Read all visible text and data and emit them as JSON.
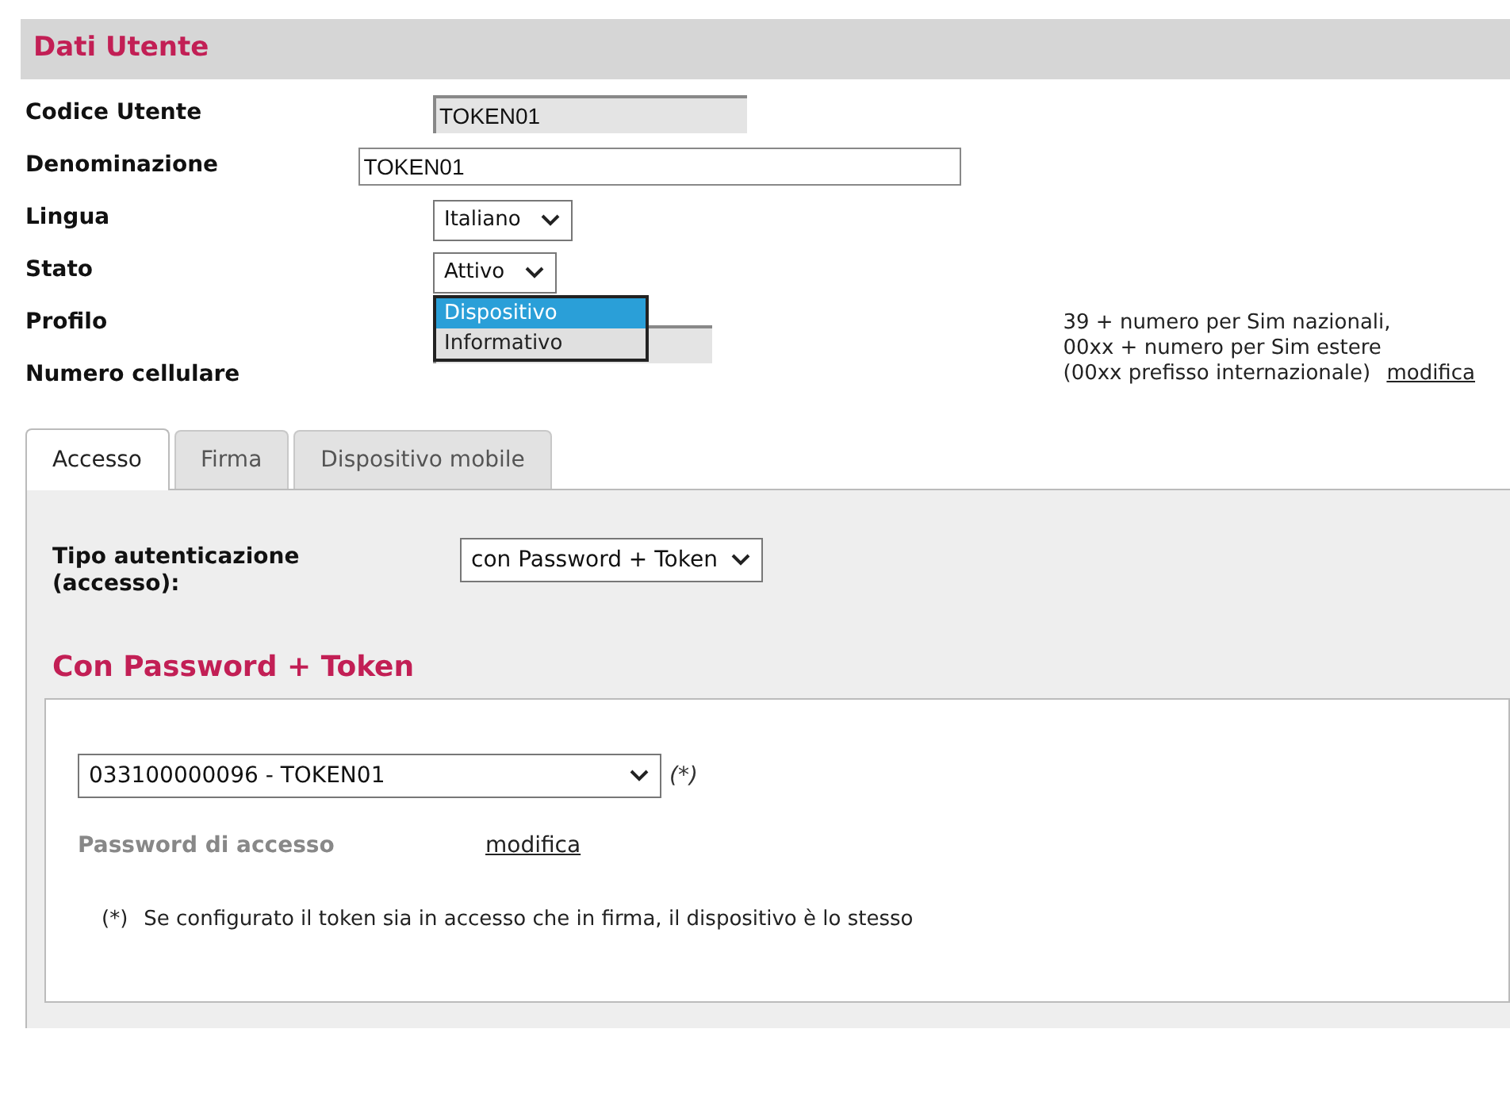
{
  "section_title": "Dati Utente",
  "fields": [
    {
      "kind": "readonly",
      "label": "Codice Utente",
      "value": "TOKEN01"
    },
    {
      "kind": "text",
      "label": "Denominazione",
      "value": "TOKEN01"
    },
    {
      "kind": "select",
      "label": "Lingua",
      "value": "Italiano"
    },
    {
      "kind": "select",
      "label": "Stato",
      "value": "Attivo"
    },
    {
      "kind": "open-list",
      "label": "Profilo",
      "options": [
        {
          "label": "Dispositivo",
          "selected": true
        },
        {
          "label": "Informativo",
          "selected": false
        }
      ]
    },
    {
      "kind": "readonly-covered",
      "label": "Numero cellulare"
    }
  ],
  "phone_help": {
    "lines": [
      "39 + numero per Sim nazionali,",
      "00xx + numero per Sim estere",
      "(00xx prefisso internazionale)"
    ],
    "link": "modifica"
  },
  "tabs": [
    {
      "label": "Accesso",
      "selected": true
    },
    {
      "label": "Firma",
      "selected": false
    },
    {
      "label": "Dispositivo mobile",
      "selected": false
    }
  ],
  "auth": {
    "label_lines": [
      "Tipo autenticazione",
      "(accesso):"
    ],
    "value": "con Password + Token"
  },
  "subsection_title": "Con Password + Token",
  "token": {
    "value": "033100000096 - TOKEN01",
    "mark": "(*)"
  },
  "password": {
    "label": "Password di accesso",
    "link": "modifica"
  },
  "footnote": {
    "mark": "(*)",
    "text": "Se configurato il token sia in accesso che in firma, il dispositivo è lo stesso"
  }
}
